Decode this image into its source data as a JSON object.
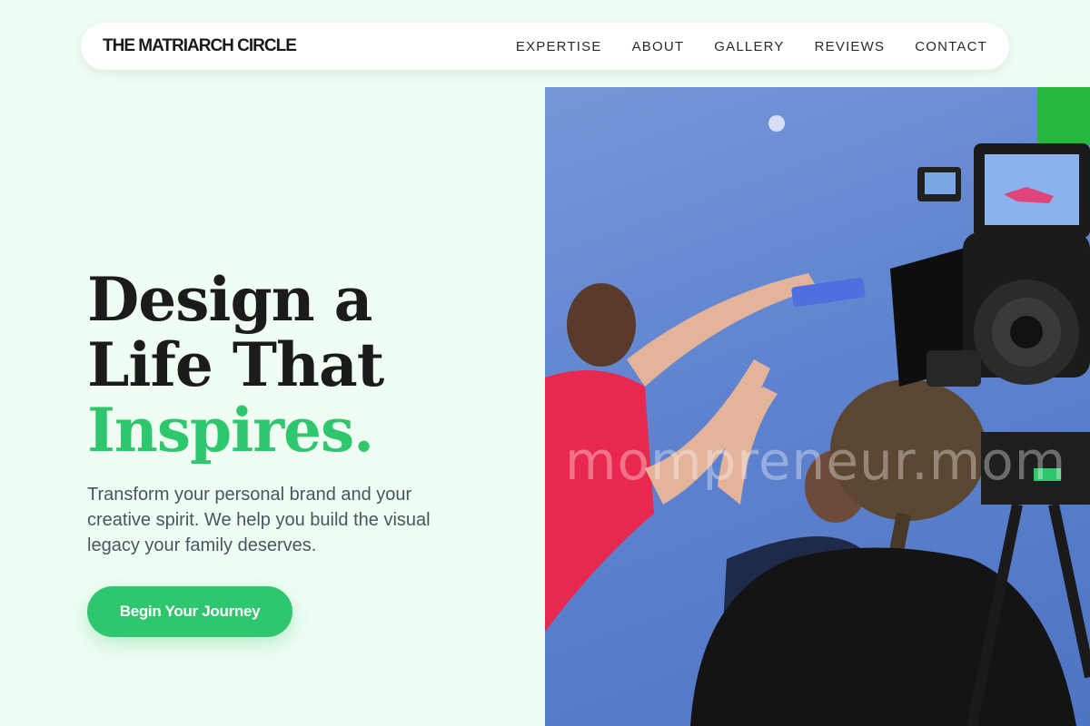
{
  "header": {
    "brand": "THE MATRIARCH CIRCLE",
    "nav": [
      "EXPERTISE",
      "ABOUT",
      "GALLERY",
      "REVIEWS",
      "CONTACT"
    ]
  },
  "hero": {
    "title_line1": "Design a",
    "title_line2": "Life That",
    "title_accent": "Inspires.",
    "subtitle": "Transform your personal brand and your creative spirit. We help you build the visual legacy your family deserves.",
    "cta_label": "Begin Your Journey"
  },
  "image": {
    "watermark": "mompreneur.mom",
    "description_icon": "film-studio-photo"
  },
  "colors": {
    "background": "#effdf3",
    "accent": "#2ec76d",
    "text_dark": "#1b1b1b",
    "text_muted": "#4a5560"
  }
}
